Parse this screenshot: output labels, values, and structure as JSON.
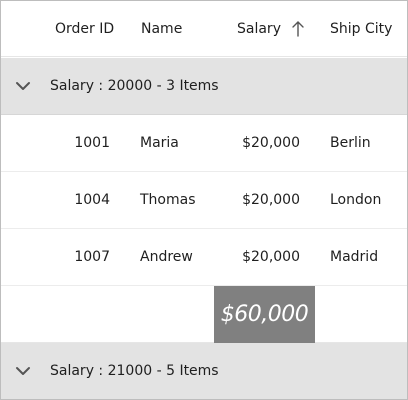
{
  "columns": {
    "order_id": "Order ID",
    "name": "Name",
    "salary": "Salary",
    "ship_city": "Ship City"
  },
  "sort_icon": "arrow-up-icon",
  "groups": [
    {
      "caption": "Salary : 20000 - 3 Items",
      "expanded": true,
      "rows": [
        {
          "order_id": "1001",
          "name": "Maria",
          "salary": "$20,000",
          "ship_city": "Berlin"
        },
        {
          "order_id": "1004",
          "name": "Thomas",
          "salary": "$20,000",
          "ship_city": "London"
        },
        {
          "order_id": "1007",
          "name": "Andrew",
          "salary": "$20,000",
          "ship_city": "Madrid"
        }
      ],
      "summary": "$60,000"
    },
    {
      "caption": "Salary : 21000 - 5 Items",
      "expanded": true
    }
  ],
  "colors": {
    "group_row_bg": "#e3e3e3",
    "summary_bg": "#808080",
    "summary_text": "#ffffff"
  }
}
